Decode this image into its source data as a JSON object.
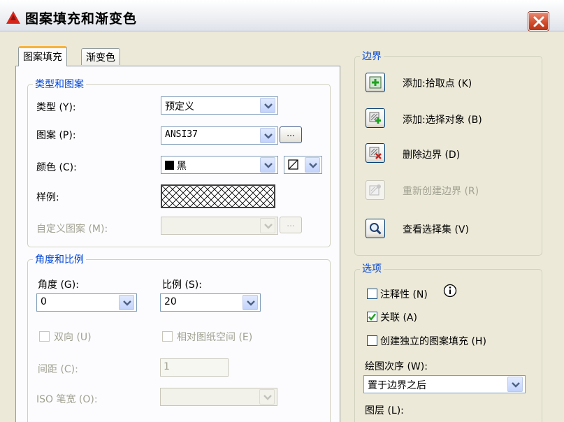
{
  "window": {
    "title": "图案填充和渐变色"
  },
  "tabs": [
    {
      "label": "图案填充",
      "active": true
    },
    {
      "label": "渐变色",
      "active": false
    }
  ],
  "type_pattern": {
    "legend": "类型和图案",
    "type_label": "类型 (Y):",
    "type_value": "预定义",
    "pattern_label": "图案 (P):",
    "pattern_value": "ANSI37",
    "pattern_button": "...",
    "color_label": "颜色 (C):",
    "color_value": "黑",
    "color_swatch": "#000000",
    "sample_label": "样例:",
    "custom_label": "自定义图案 (M):",
    "custom_value": "",
    "custom_button": "..."
  },
  "angle_scale": {
    "legend": "角度和比例",
    "angle_label": "角度 (G):",
    "angle_value": "0",
    "scale_label": "比例 (S):",
    "scale_value": "20",
    "double_label": "双向 (U)",
    "relative_label": "相对图纸空间 (E)",
    "spacing_label": "间距 (C):",
    "spacing_value": "1",
    "iso_label": "ISO 笔宽 (O):",
    "iso_value": ""
  },
  "boundary": {
    "legend": "边界",
    "add_pick": "添加:拾取点 (K)",
    "add_select": "添加:选择对象 (B)",
    "remove": "删除边界 (D)",
    "recreate": "重新创建边界 (R)",
    "view_selection": "查看选择集 (V)"
  },
  "options": {
    "legend": "选项",
    "annotative_label": "注释性 (N)",
    "annotative_checked": false,
    "associative_label": "关联 (A)",
    "associative_checked": true,
    "separate_label": "创建独立的图案填充 (H)",
    "separate_checked": false,
    "draw_order_label": "绘图次序 (W):",
    "draw_order_value": "置于边界之后",
    "layer_label": "图层 (L):"
  },
  "colors": {
    "accent_blue": "#0046d5",
    "tab_highlight": "#f7b23a",
    "check_green": "#21a121",
    "close_red": "#cf4b2c"
  }
}
